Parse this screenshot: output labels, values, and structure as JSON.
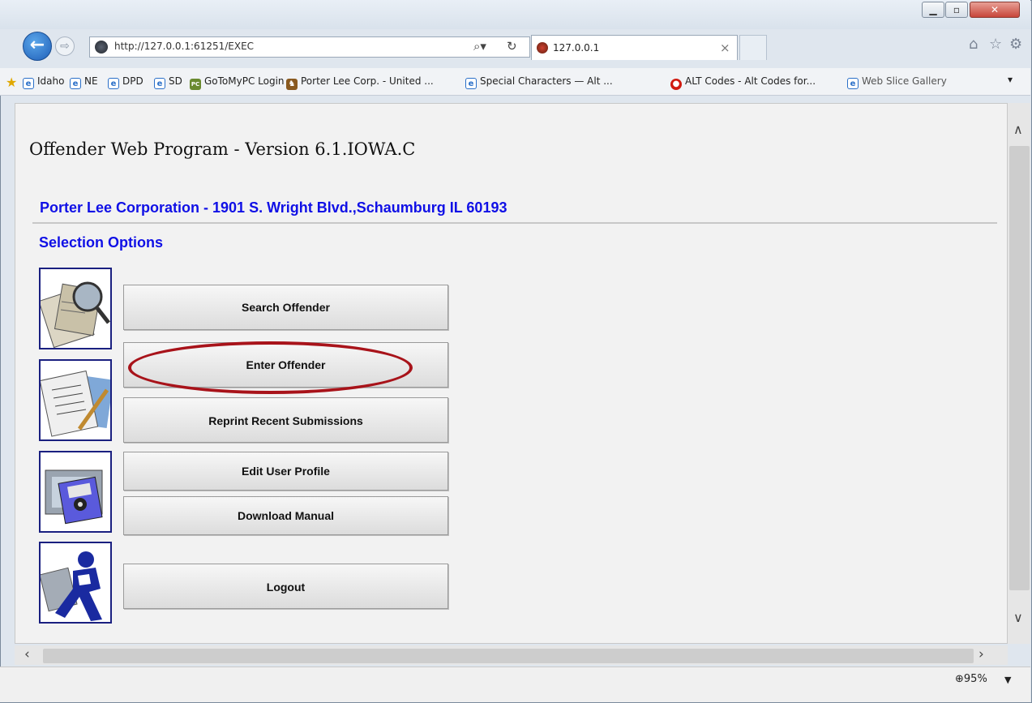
{
  "browser": {
    "address_url": "http://127.0.0.1:61251/EXEC",
    "tab_title": "127.0.0.1",
    "favorites": [
      "Idaho",
      "NE",
      "DPD",
      "SD",
      "GoToMyPC Login",
      "Porter Lee Corp. - United ...",
      "Special Characters — Alt ...",
      "ALT Codes - Alt Codes for...",
      "Web Slice Gallery"
    ],
    "zoom": "95%"
  },
  "page": {
    "app_title": "Offender Web Program - Version 6.1.IOWA.C",
    "company": "Porter Lee Corporation - 1901 S. Wright Blvd.,Schaumburg IL 60193",
    "section_title": "Selection Options",
    "buttons": [
      "Search Offender",
      "Enter Offender",
      "Reprint Recent Submissions",
      "Edit User Profile",
      "Download Manual",
      "Logout"
    ],
    "tile_icons": [
      "magnifier-documents-icon",
      "document-pen-icon",
      "floppy-disk-computer-icon",
      "runner-icon"
    ]
  },
  "colors": {
    "accent_blue": "#1010e6",
    "highlight_red": "#a8131a"
  }
}
